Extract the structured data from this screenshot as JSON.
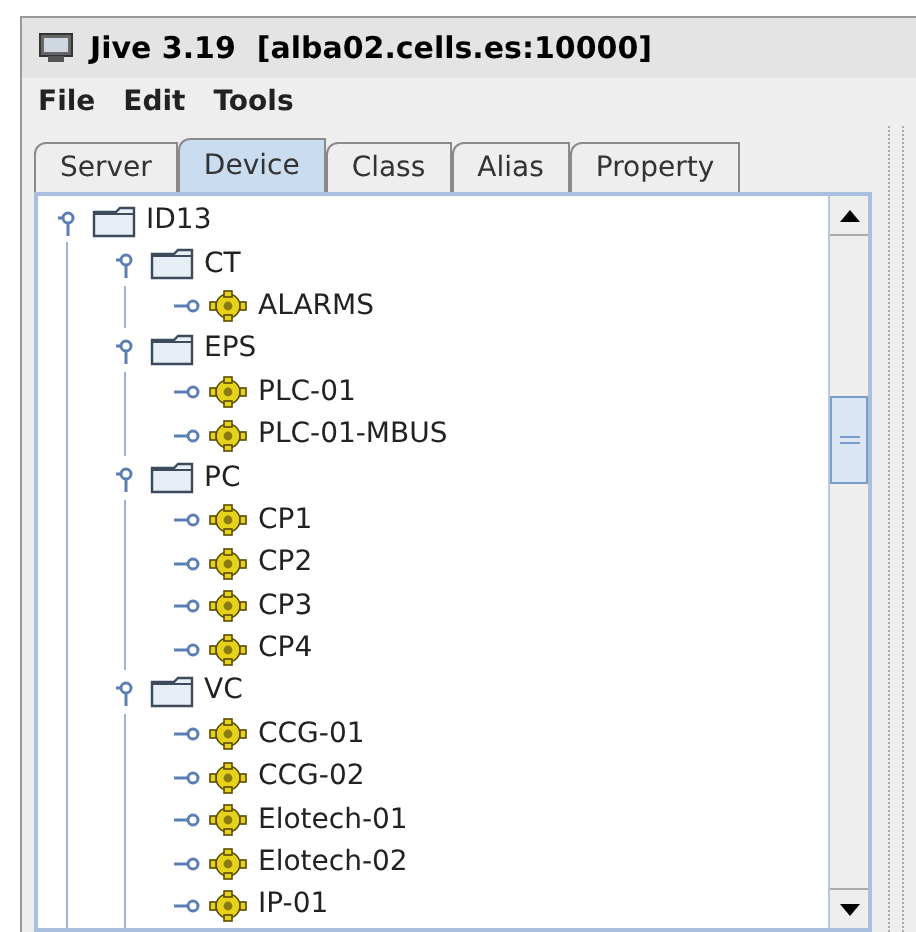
{
  "window": {
    "title": "Jive 3.19  [alba02.cells.es:10000]"
  },
  "menu": [
    "File",
    "Edit",
    "Tools"
  ],
  "tabs": [
    {
      "label": "Server",
      "selected": false
    },
    {
      "label": "Device",
      "selected": true
    },
    {
      "label": "Class",
      "selected": false
    },
    {
      "label": "Alias",
      "selected": false
    },
    {
      "label": "Property",
      "selected": false
    }
  ],
  "tree": [
    {
      "label": "ID13",
      "kind": "folder",
      "expanded": true,
      "children": [
        {
          "label": "CT",
          "kind": "folder",
          "expanded": true,
          "children": [
            {
              "label": "ALARMS",
              "kind": "device",
              "expanded": false
            }
          ]
        },
        {
          "label": "EPS",
          "kind": "folder",
          "expanded": true,
          "children": [
            {
              "label": "PLC-01",
              "kind": "device",
              "expanded": false
            },
            {
              "label": "PLC-01-MBUS",
              "kind": "device",
              "expanded": false
            }
          ]
        },
        {
          "label": "PC",
          "kind": "folder",
          "expanded": true,
          "children": [
            {
              "label": "CP1",
              "kind": "device",
              "expanded": false
            },
            {
              "label": "CP2",
              "kind": "device",
              "expanded": false
            },
            {
              "label": "CP3",
              "kind": "device",
              "expanded": false
            },
            {
              "label": "CP4",
              "kind": "device",
              "expanded": false
            }
          ]
        },
        {
          "label": "VC",
          "kind": "folder",
          "expanded": true,
          "children": [
            {
              "label": "CCG-01",
              "kind": "device",
              "expanded": false
            },
            {
              "label": "CCG-02",
              "kind": "device",
              "expanded": false
            },
            {
              "label": "Elotech-01",
              "kind": "device",
              "expanded": false
            },
            {
              "label": "Elotech-02",
              "kind": "device",
              "expanded": false
            },
            {
              "label": "IP-01",
              "kind": "device",
              "expanded": false
            }
          ]
        }
      ]
    }
  ]
}
